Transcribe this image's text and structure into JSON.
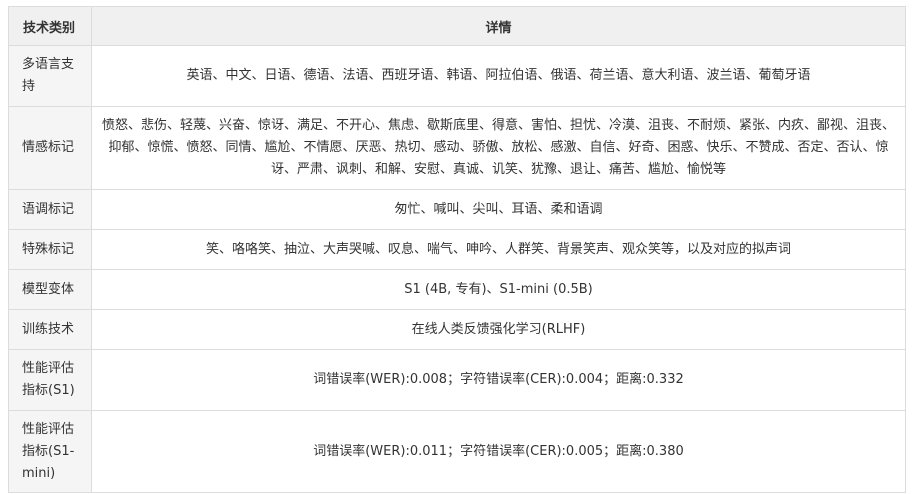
{
  "table": {
    "headers": [
      "技术类别",
      "详情"
    ],
    "rows": [
      {
        "category": "多语言支持",
        "detail": "英语、中文、日语、德语、法语、西班牙语、韩语、阿拉伯语、俄语、荷兰语、意大利语、波兰语、葡萄牙语"
      },
      {
        "category": "情感标记",
        "detail": "愤怒、悲伤、轻蔑、兴奋、惊讶、满足、不开心、焦虑、歇斯底里、得意、害怕、担忧、冷漠、沮丧、不耐烦、紧张、内疚、鄙视、沮丧、抑郁、惊慌、愤怒、同情、尴尬、不情愿、厌恶、热切、感动、骄傲、放松、感激、自信、好奇、困惑、快乐、不赞成、否定、否认、惊讶、严肃、讽刺、和解、安慰、真诚、讥笑、犹豫、退让、痛苦、尴尬、愉悦等"
      },
      {
        "category": "语调标记",
        "detail": "匆忙、喊叫、尖叫、耳语、柔和语调"
      },
      {
        "category": "特殊标记",
        "detail": "笑、咯咯笑、抽泣、大声哭喊、叹息、喘气、呻吟、人群笑、背景笑声、观众笑等，以及对应的拟声词"
      },
      {
        "category": "模型变体",
        "detail": "S1 (4B, 专有)、S1-mini (0.5B)"
      },
      {
        "category": "训练技术",
        "detail": "在线人类反馈强化学习(RLHF)"
      },
      {
        "category": "性能评估指标(S1)",
        "detail": "词错误率(WER):0.008；字符错误率(CER):0.004；距离:0.332"
      },
      {
        "category": "性能评估指标(S1-mini)",
        "detail": "词错误率(WER):0.011；字符错误率(CER):0.005；距离:0.380"
      }
    ]
  }
}
